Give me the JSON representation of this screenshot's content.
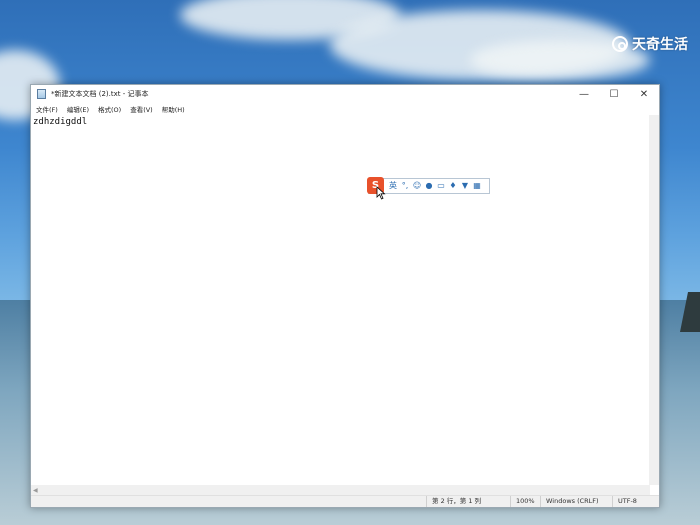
{
  "watermark": {
    "text": "天奇生活"
  },
  "window": {
    "title": "*新建文本文档 (2).txt - 记事本",
    "controls": {
      "minimize": "—",
      "maximize": "☐",
      "close": "✕"
    }
  },
  "menu": {
    "items": [
      {
        "label": "文件(F)"
      },
      {
        "label": "编辑(E)"
      },
      {
        "label": "格式(O)"
      },
      {
        "label": "查看(V)"
      },
      {
        "label": "帮助(H)"
      }
    ]
  },
  "editor": {
    "content": "zdhzdigddl"
  },
  "statusbar": {
    "position": "第 2 行，第 1 列",
    "zoom": "100%",
    "line_ending": "Windows (CRLF)",
    "encoding": "UTF-8"
  },
  "ime": {
    "logo_text": "S",
    "icons": [
      "ime-chinese-icon",
      "ime-punct-icon",
      "ime-emoji-icon",
      "ime-voice-icon",
      "ime-keyboard-icon",
      "ime-tools-icon",
      "ime-skin-icon",
      "ime-grid-icon"
    ],
    "mode_label": "英",
    "accent": "#e8512b"
  }
}
